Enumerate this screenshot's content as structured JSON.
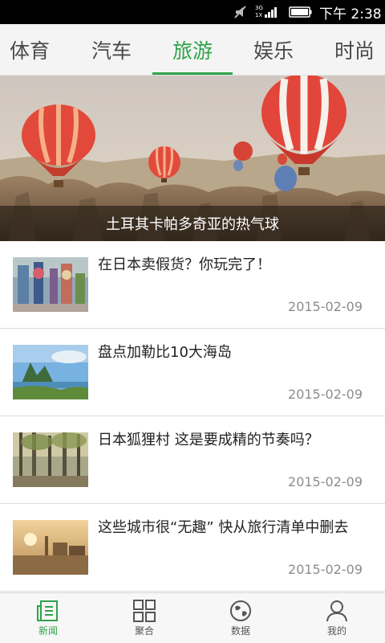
{
  "status_bar": {
    "net_top": "3G",
    "net_bottom": "1X",
    "time": "下午 2:38"
  },
  "tabs": [
    {
      "label": "体育"
    },
    {
      "label": "汽车"
    },
    {
      "label": "旅游",
      "active": true
    },
    {
      "label": "娱乐"
    },
    {
      "label": "时尚"
    }
  ],
  "banner": {
    "caption": "土耳其卡帕多奇亚的热气球"
  },
  "news": [
    {
      "title": "在日本卖假货？你玩完了！",
      "date": "2015-02-09"
    },
    {
      "title": "盘点加勒比10大海岛",
      "date": "2015-02-09"
    },
    {
      "title": "日本狐狸村 这是要成精的节奏吗？",
      "date": "2015-02-09"
    },
    {
      "title": "这些城市很“无趣” 快从旅行清单中删去",
      "date": "2015-02-09"
    }
  ],
  "bottom_nav": [
    {
      "label": "新闻",
      "icon": "news-icon",
      "active": true
    },
    {
      "label": "聚合",
      "icon": "grid-icon"
    },
    {
      "label": "数据",
      "icon": "globe-icon"
    },
    {
      "label": "我的",
      "icon": "profile-icon"
    }
  ],
  "colors": {
    "accent": "#2fa34a"
  }
}
